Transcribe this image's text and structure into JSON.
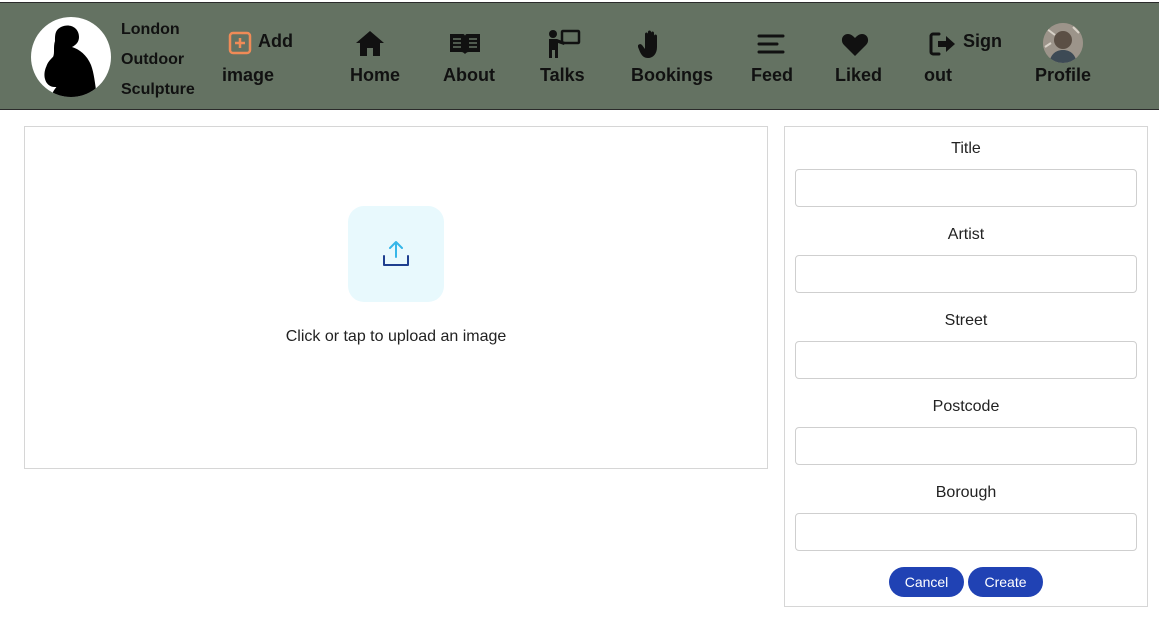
{
  "brand": {
    "line1": "London",
    "line2": "Outdoor",
    "line3": "Sculpture"
  },
  "nav": {
    "add_image": {
      "line1": "Add",
      "line2": "image",
      "icon": "add-square-icon",
      "color": "#f08b57"
    },
    "home": {
      "label": "Home",
      "icon": "home-icon"
    },
    "about": {
      "label": "About",
      "icon": "book-icon"
    },
    "talks": {
      "label": "Talks",
      "icon": "presenter-icon"
    },
    "bookings": {
      "label": "Bookings",
      "icon": "hand-icon"
    },
    "feed": {
      "label": "Feed",
      "icon": "feed-lines-icon"
    },
    "liked": {
      "label": "Liked",
      "icon": "heart-icon"
    },
    "sign_out": {
      "line1": "Sign",
      "line2": "out",
      "icon": "sign-out-icon"
    },
    "profile": {
      "label": "Profile",
      "icon": "avatar"
    }
  },
  "upload": {
    "text": "Click or tap to upload an image",
    "icon": "upload-icon"
  },
  "form": {
    "fields": [
      {
        "label": "Title",
        "value": ""
      },
      {
        "label": "Artist",
        "value": ""
      },
      {
        "label": "Street",
        "value": ""
      },
      {
        "label": "Postcode",
        "value": ""
      },
      {
        "label": "Borough",
        "value": ""
      }
    ],
    "cancel_label": "Cancel",
    "create_label": "Create"
  },
  "colors": {
    "navbar": "#647262",
    "button": "#2042b4",
    "upload_tile": "#e8f9fd",
    "accent_orange": "#f08b57"
  }
}
